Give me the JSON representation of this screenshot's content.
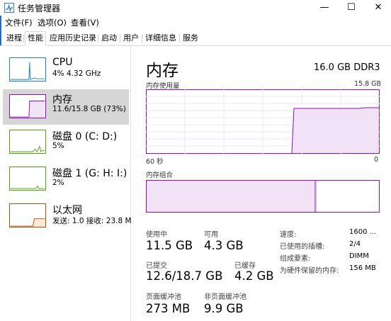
{
  "window": {
    "title": "任务管理器",
    "controls": {
      "minimize": "—",
      "maximize": "☐",
      "close": "✕"
    }
  },
  "menu": [
    "文件(F)",
    "选项(O)",
    "查看(V)"
  ],
  "tabs": [
    "进程",
    "性能",
    "应用历史记录",
    "启动",
    "用户",
    "详细信息",
    "服务"
  ],
  "active_tab": "性能",
  "sidebar": [
    {
      "name": "CPU",
      "detail": "4% 4.32 GHz",
      "color": "#1f7fc4"
    },
    {
      "name": "内存",
      "detail": "11.6/15.8 GB (73%)",
      "color": "#8b12ae"
    },
    {
      "name": "磁盘 0 (C: D:)",
      "detail": "5%",
      "color": "#4da60c"
    },
    {
      "name": "磁盘 1 (G: H: I:)",
      "detail": "2%",
      "color": "#4da60c"
    },
    {
      "name": "以太网",
      "detail": "发送: 1.0 接收: 23.8 M",
      "color": "#a74f01"
    }
  ],
  "memory": {
    "title": "内存",
    "spec": "16.0 GB DDR3",
    "usage_label": "内存使用量",
    "usage_max": "15.8 GB",
    "time_left": "60 秒",
    "time_right": "0",
    "composition_label": "内存组合",
    "usage_fraction_recent": 0.73,
    "stats": [
      {
        "label": "使用中",
        "value": "11.5 GB"
      },
      {
        "label": "可用",
        "value": "4.3 GB"
      },
      {
        "label": "已提交",
        "value": "12.6/18.7 GB"
      },
      {
        "label": "已缓存",
        "value": "4.2 GB"
      },
      {
        "label": "页面缓冲池",
        "value": "273 MB"
      },
      {
        "label": "非页面缓冲池",
        "value": "9.9 GB"
      }
    ],
    "details": [
      {
        "key": "速度:",
        "value": "1600 ..."
      },
      {
        "key": "已使用的插槽:",
        "value": "2/4"
      },
      {
        "key": "组成要素:",
        "value": "DIMM"
      },
      {
        "key": "为硬件保留的内存:",
        "value": "156 MB"
      }
    ],
    "accent": "#8b12ae"
  }
}
